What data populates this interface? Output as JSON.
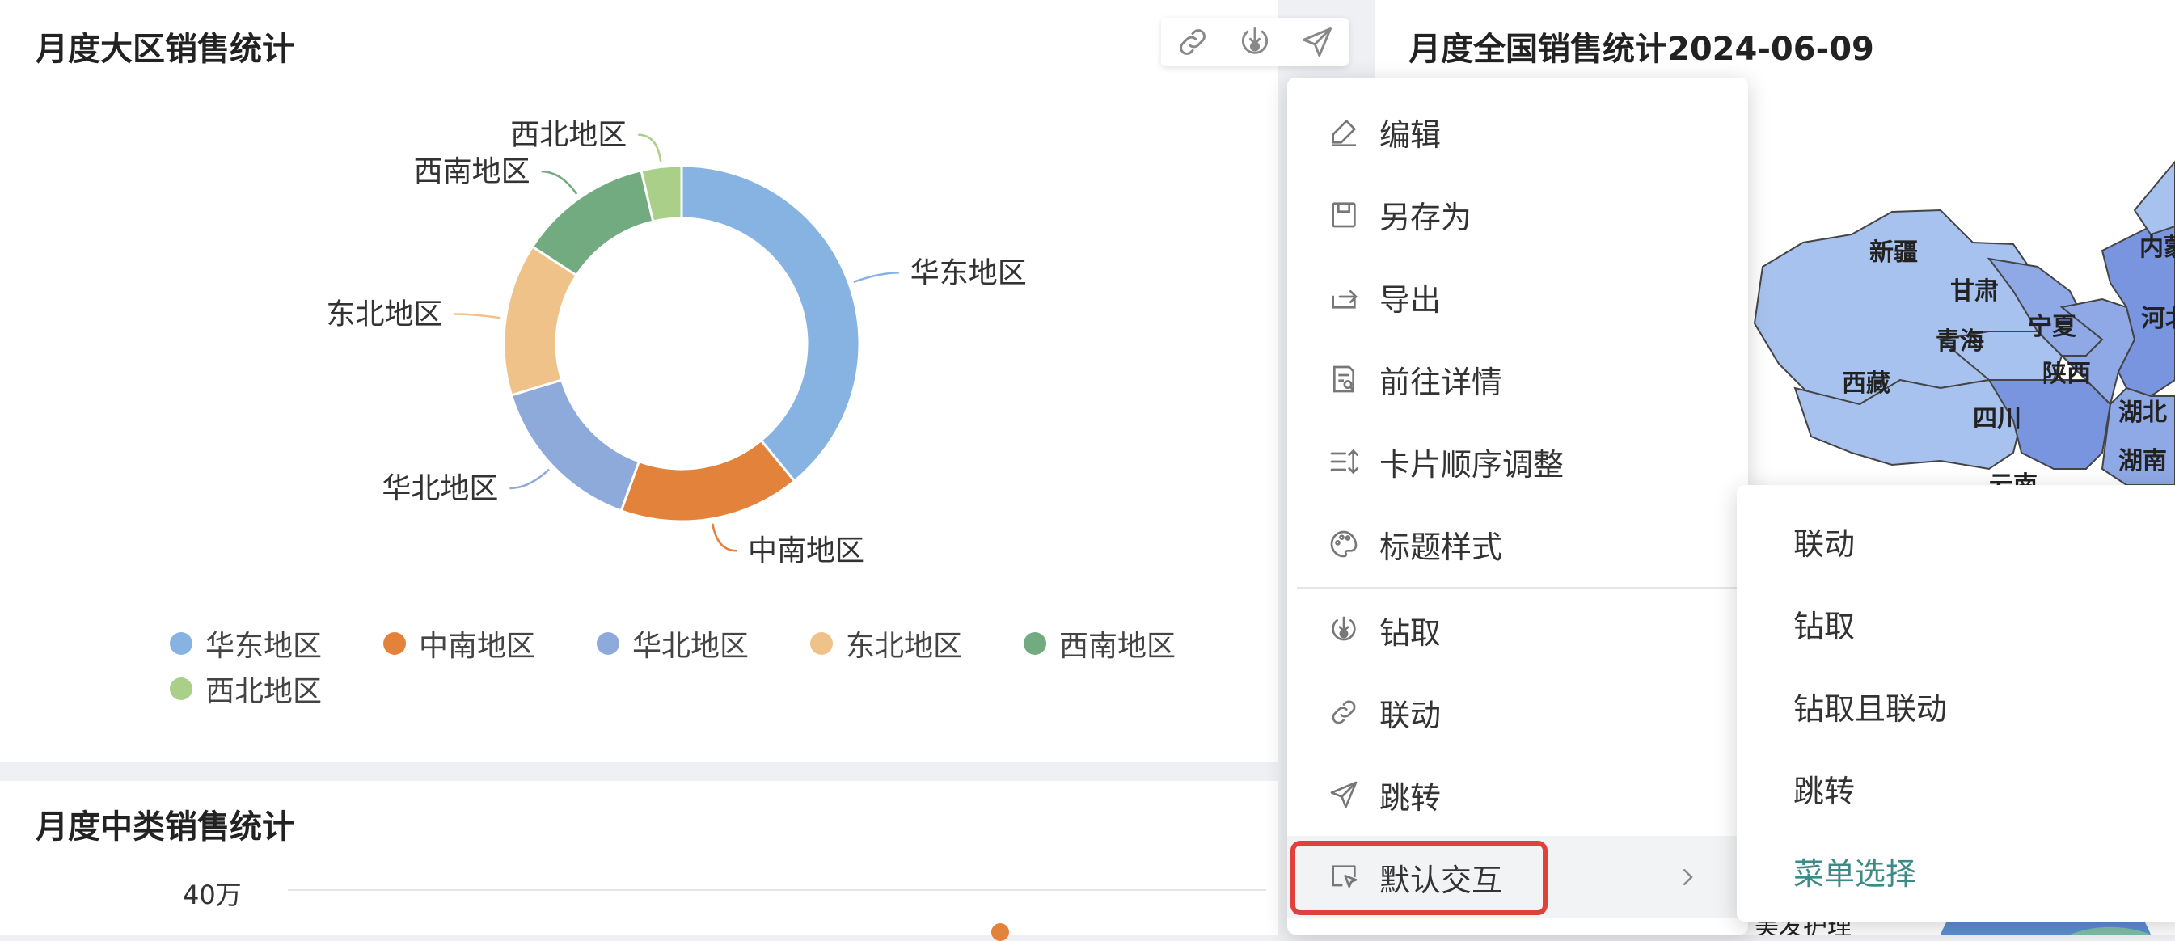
{
  "cards": {
    "region": {
      "title": "月度大区销售统计"
    },
    "map": {
      "title": "月度全国销售统计2024-06-09"
    },
    "category": {
      "title": "月度中类销售统计",
      "y_tick": "40万"
    }
  },
  "toolbar": {
    "icons": [
      "link-icon",
      "drill-icon",
      "send-icon"
    ]
  },
  "chart_data": {
    "type": "pie",
    "variant": "donut",
    "categories": [
      "华东地区",
      "中南地区",
      "华北地区",
      "东北地区",
      "西南地区",
      "西北地区"
    ],
    "values": [
      37.5,
      15.8,
      14.2,
      13.3,
      11.7,
      3.5
    ],
    "colors": [
      "#86b3e1",
      "#e3823a",
      "#8eaadb",
      "#efc28a",
      "#72ab7f",
      "#a9cf89"
    ],
    "legend": "bottom"
  },
  "map": {
    "provinces": [
      "新疆",
      "甘肃",
      "青海",
      "宁夏",
      "西藏",
      "四川",
      "陕西",
      "湖北",
      "湖南",
      "河北",
      "内蒙",
      "云南"
    ],
    "partial_label": "美发护理"
  },
  "menu": {
    "items": [
      {
        "label": "编辑",
        "icon": "edit-icon"
      },
      {
        "label": "另存为",
        "icon": "save-as-icon"
      },
      {
        "label": "导出",
        "icon": "export-icon"
      },
      {
        "label": "前往详情",
        "icon": "details-icon"
      },
      {
        "label": "卡片顺序调整",
        "icon": "reorder-icon"
      },
      {
        "label": "标题样式",
        "icon": "palette-icon"
      },
      {
        "label": "钻取",
        "icon": "drill-icon"
      },
      {
        "label": "联动",
        "icon": "link-icon"
      },
      {
        "label": "跳转",
        "icon": "send-icon"
      },
      {
        "label": "默认交互",
        "icon": "pointer-icon"
      }
    ]
  },
  "submenu": {
    "items": [
      "联动",
      "钻取",
      "钻取且联动",
      "跳转",
      "菜单选择"
    ],
    "selected": "菜单选择",
    "selected_color": "#3d8a86"
  },
  "highlight_color": "#e0413b"
}
